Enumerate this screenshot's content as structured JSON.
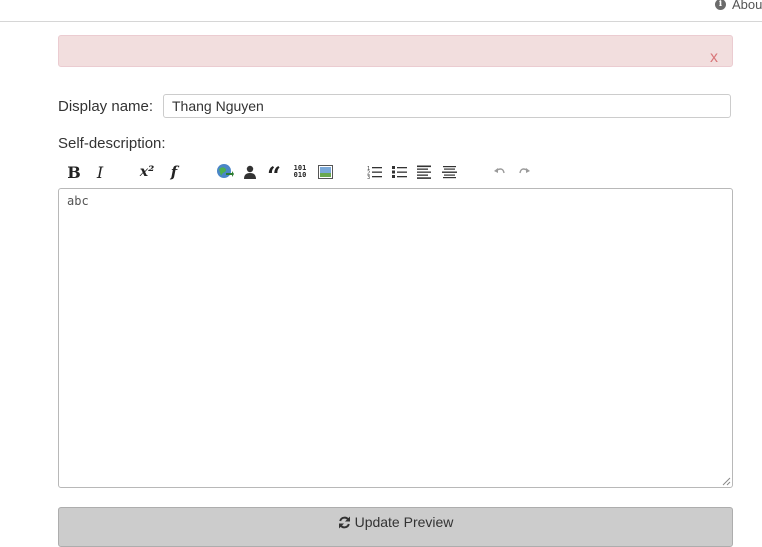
{
  "header": {
    "about_label": "About",
    "info_icon_glyph": "i"
  },
  "alert": {
    "close_label": "x",
    "background": "#f2dede",
    "close_color": "#d9777a"
  },
  "form": {
    "display_name_label": "Display name:",
    "display_name_value": "Thang Nguyen",
    "self_description_label": "Self-description:",
    "self_description_value": "abc"
  },
  "toolbar": {
    "bold_label": "B",
    "italic_label": "I",
    "superscript_label": "x²",
    "function_label": "f",
    "quote_label": "“",
    "code_label_top": "101",
    "code_label_bottom": "010",
    "icons": [
      "bold-icon",
      "italic-icon",
      "superscript-icon",
      "function-icon",
      "link-icon",
      "user-icon",
      "quote-icon",
      "code-icon",
      "image-icon",
      "ordered-list-icon",
      "unordered-list-icon",
      "heading-icon",
      "horizontal-rule-icon",
      "undo-icon",
      "redo-icon"
    ]
  },
  "preview": {
    "button_label": "Update Preview"
  }
}
